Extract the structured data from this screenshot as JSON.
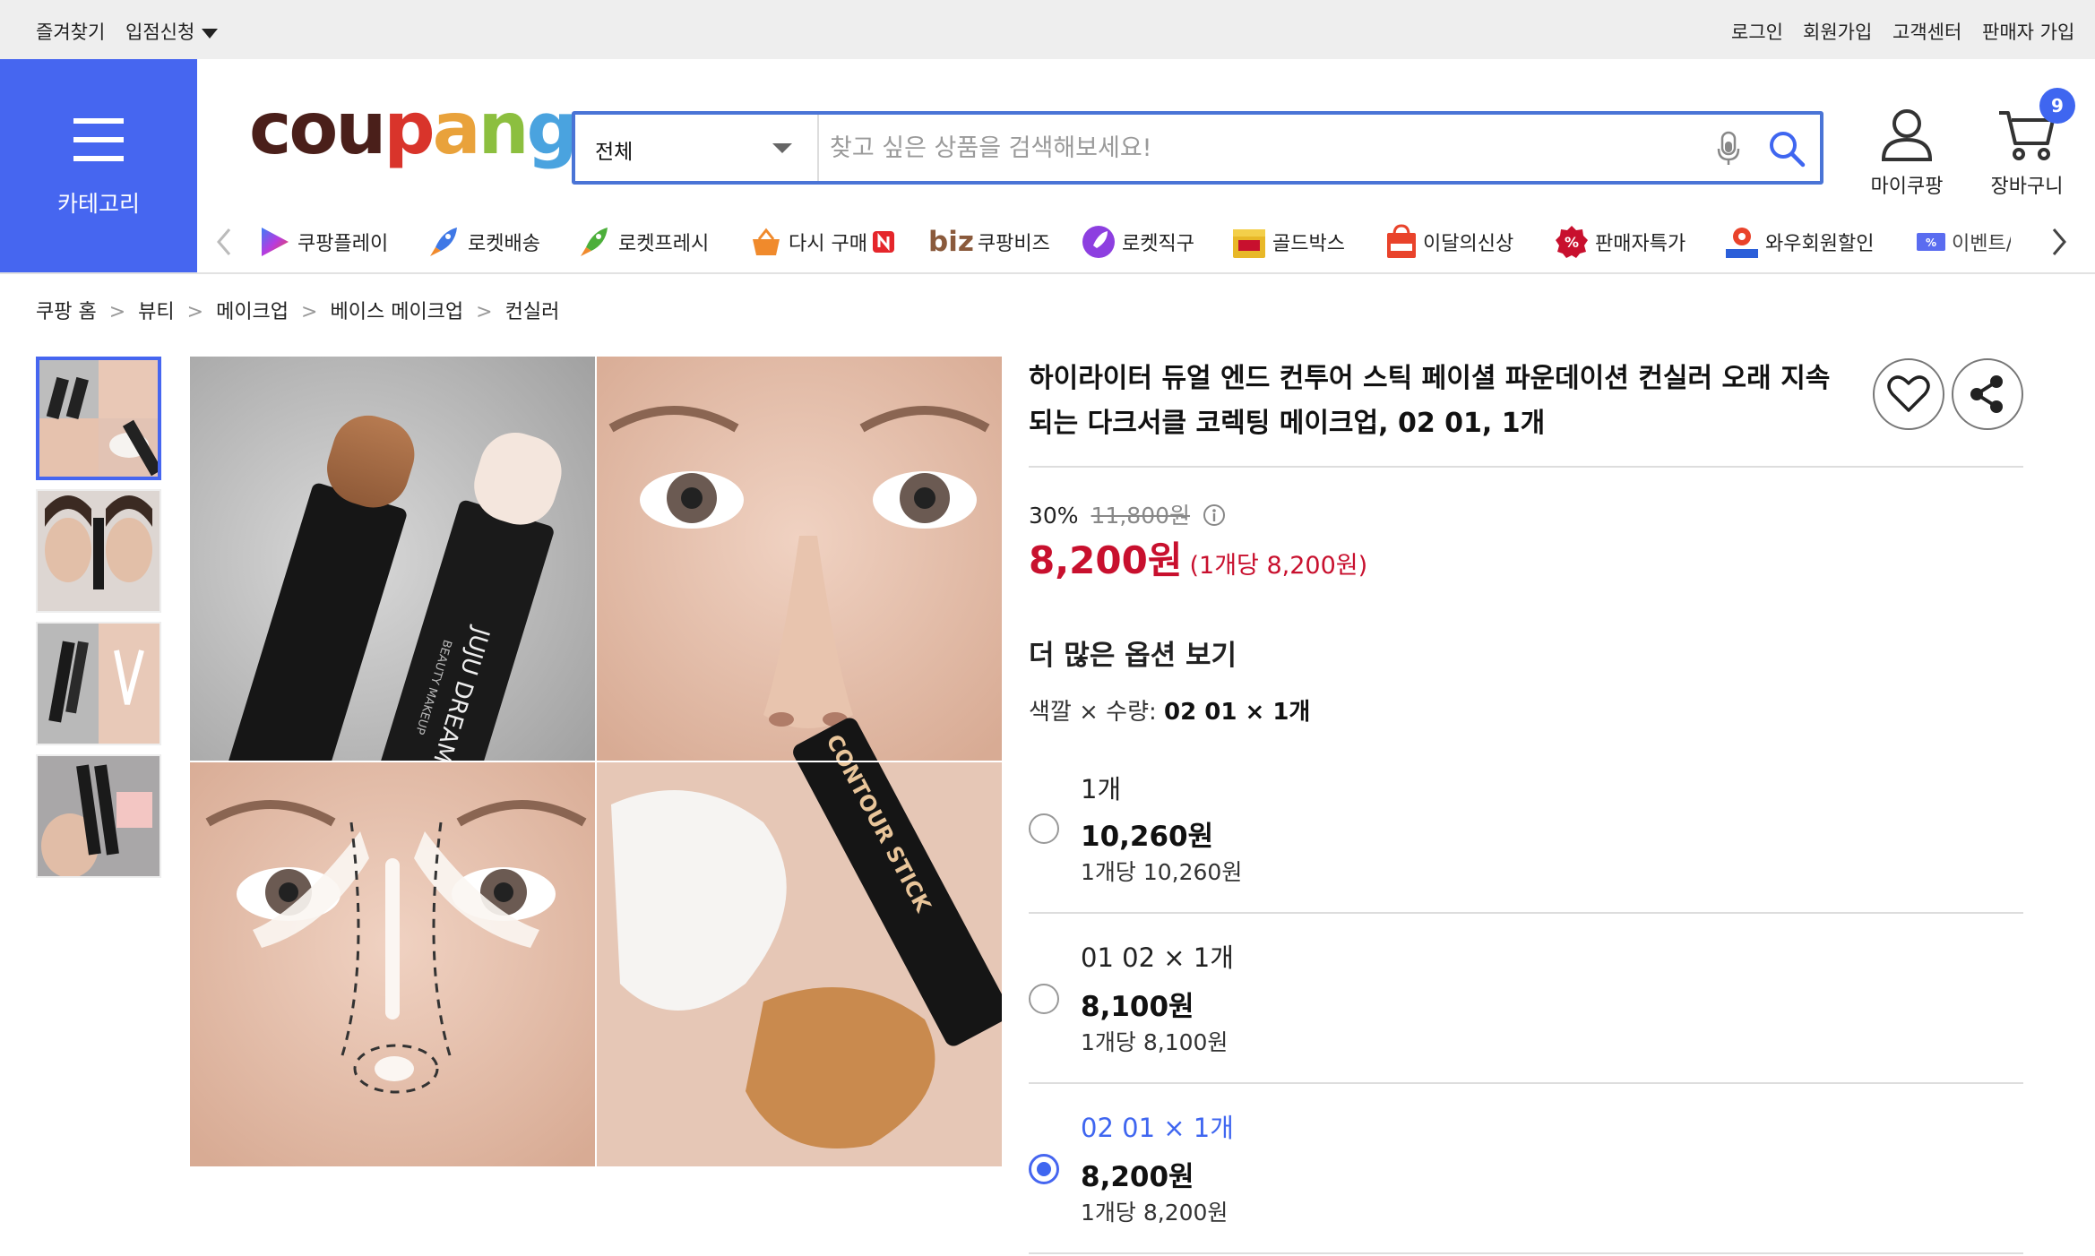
{
  "topbar": {
    "favorites": "즐겨찾기",
    "store_apply": "입점신청",
    "login": "로그인",
    "signup": "회원가입",
    "customer_center": "고객센터",
    "seller_signup": "판매자 가입"
  },
  "header": {
    "category_label": "카테고리",
    "logo_letters": [
      {
        "ch": "c",
        "color": "#4a1f1a"
      },
      {
        "ch": "o",
        "color": "#4a1f1a"
      },
      {
        "ch": "u",
        "color": "#4a1f1a"
      },
      {
        "ch": "p",
        "color": "#d9342b"
      },
      {
        "ch": "a",
        "color": "#e9a23b"
      },
      {
        "ch": "n",
        "color": "#8cbf3f"
      },
      {
        "ch": "g",
        "color": "#4aa3df"
      }
    ],
    "search_scope": "전체",
    "search_placeholder": "찾고 싶은 상품을 검색해보세요!",
    "mycoupang": "마이쿠팡",
    "cart": "장바구니",
    "cart_count": "9"
  },
  "nav": [
    {
      "label": "쿠팡플레이",
      "icon": "coupang-play-icon"
    },
    {
      "label": "로켓배송",
      "icon": "rocket-icon"
    },
    {
      "label": "로켓프레시",
      "icon": "rocket-fresh-icon"
    },
    {
      "label": "다시 구매",
      "icon": "basket-icon"
    },
    {
      "label": "쿠팡비즈",
      "icon": "biz-icon",
      "prefix": "biz"
    },
    {
      "label": "로켓직구",
      "icon": "rocket-global-icon"
    },
    {
      "label": "골드박스",
      "icon": "goldbox-icon"
    },
    {
      "label": "이달의신상",
      "icon": "new-bag-icon"
    },
    {
      "label": "판매자특가",
      "icon": "percent-badge-icon"
    },
    {
      "label": "와우회원할인",
      "icon": "wow-icon"
    },
    {
      "label": "이벤트/",
      "icon": "coupon-icon"
    }
  ],
  "breadcrumb": [
    "쿠팡 홈",
    "뷰티",
    "메이크업",
    "베이스 메이크업",
    "컨실러"
  ],
  "product": {
    "title": "하이라이터 듀얼 엔드 컨투어 스틱 페이셜 파운데이션 컨실러 오래 지속되는 다크서클 코렉팅 메이크업, 02 01, 1개",
    "discount": "30%",
    "original_price": "11,800원",
    "price": "8,200원",
    "unit_price": "(1개당 8,200원)",
    "more_options": "더 많은 옵션 보기",
    "selected_prefix": "색깔 × 수량:",
    "selected_value": "02 01 × 1개",
    "packaging_text": {
      "stick_brand": "JUJU DREAM",
      "stick_sub": "BEAUTY MAKEUP",
      "contour": "CONTOUR STICK"
    },
    "options": [
      {
        "name": "1개",
        "price": "10,260원",
        "unit": "1개당 10,260원",
        "selected": false
      },
      {
        "name": "01 02 × 1개",
        "price": "8,100원",
        "unit": "1개당 8,100원",
        "selected": false
      },
      {
        "name": "02 01 × 1개",
        "price": "8,200원",
        "unit": "1개당 8,200원",
        "selected": true
      }
    ]
  }
}
